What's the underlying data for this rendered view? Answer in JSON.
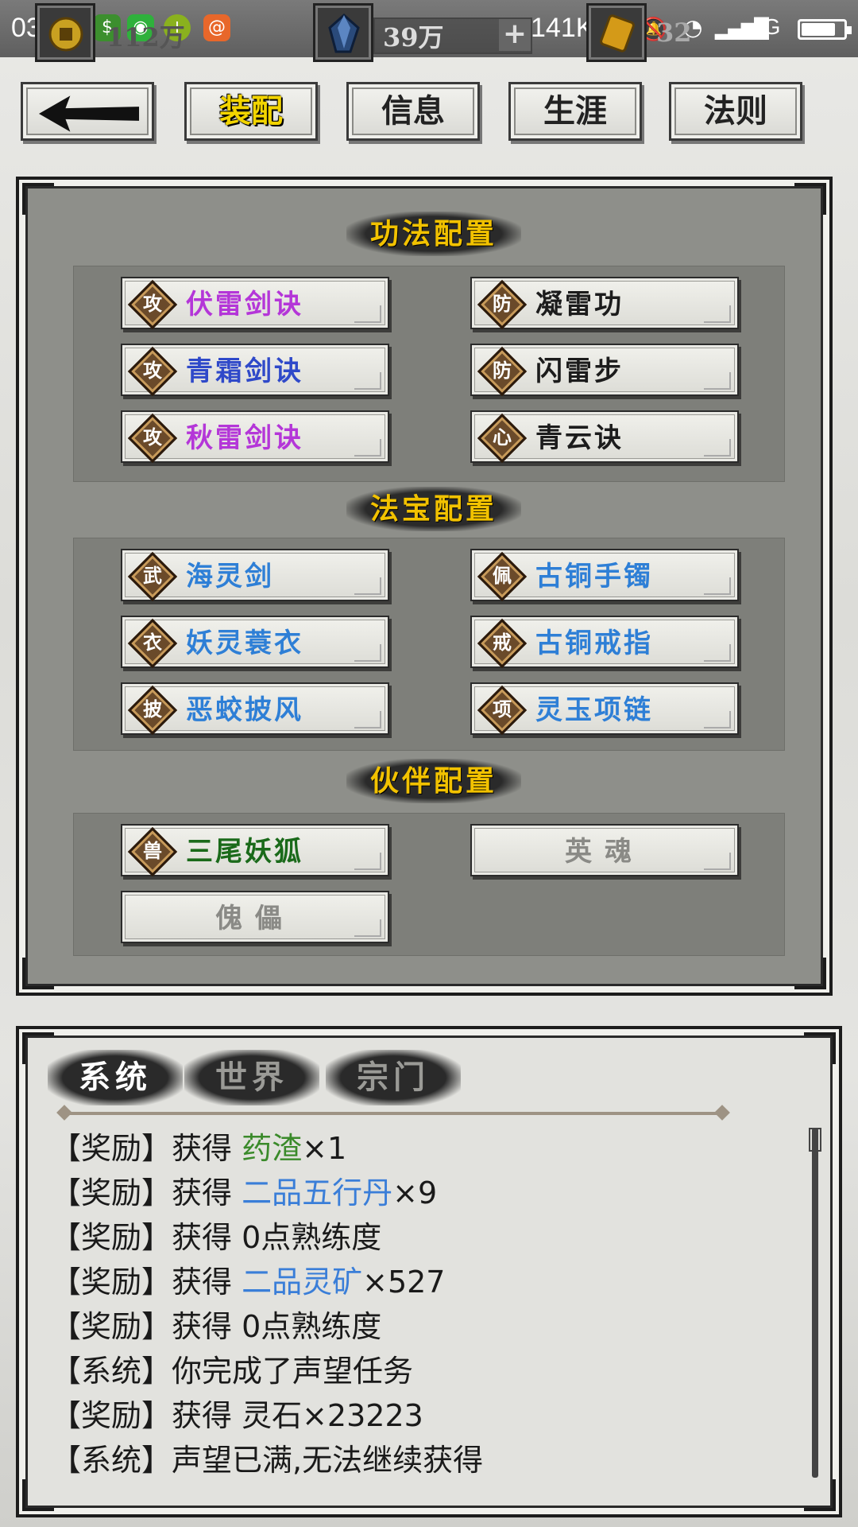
{
  "status_bar": {
    "time": "03:19",
    "net_speed": "141K/s",
    "network": "4G",
    "battery_level": 0.8
  },
  "resources": {
    "gold_partial": "112万",
    "crystal": "39万",
    "third_partial": "32"
  },
  "top_nav": {
    "back_label": "",
    "tabs": [
      {
        "label": "装配",
        "active": true
      },
      {
        "label": "信息",
        "active": false
      },
      {
        "label": "生涯",
        "active": false
      },
      {
        "label": "法则",
        "active": false
      }
    ]
  },
  "sections": {
    "skills": {
      "title": "功法配置",
      "slots": [
        {
          "badge": "攻",
          "name": "伏雷剑诀",
          "color": "#b436d8"
        },
        {
          "badge": "防",
          "name": "凝雷功",
          "color": "#1c1c1c"
        },
        {
          "badge": "攻",
          "name": "青霜剑诀",
          "color": "#2f49c9"
        },
        {
          "badge": "防",
          "name": "闪雷步",
          "color": "#1c1c1c"
        },
        {
          "badge": "攻",
          "name": "秋雷剑诀",
          "color": "#b436d8"
        },
        {
          "badge": "心",
          "name": "青云诀",
          "color": "#1c1c1c"
        }
      ]
    },
    "treasures": {
      "title": "法宝配置",
      "slots": [
        {
          "badge": "武",
          "name": "海灵剑",
          "color": "#2e7fd6"
        },
        {
          "badge": "佩",
          "name": "古铜手镯",
          "color": "#2e7fd6"
        },
        {
          "badge": "衣",
          "name": "妖灵蓑衣",
          "color": "#2e7fd6"
        },
        {
          "badge": "戒",
          "name": "古铜戒指",
          "color": "#2e7fd6"
        },
        {
          "badge": "披",
          "name": "恶蛟披风",
          "color": "#2e7fd6"
        },
        {
          "badge": "项",
          "name": "灵玉项链",
          "color": "#2e7fd6"
        }
      ]
    },
    "partners": {
      "title": "伙伴配置",
      "slots": [
        {
          "badge": "兽",
          "name": "三尾妖狐",
          "color": "#1a6a1a"
        },
        {
          "badge": "",
          "name": "英魂",
          "color": "#8a8a86",
          "empty": true
        },
        {
          "badge": "",
          "name": "傀儡",
          "color": "#8a8a86",
          "empty": true
        }
      ]
    }
  },
  "chat": {
    "tabs": [
      {
        "label": "系统",
        "active": true
      },
      {
        "label": "世界",
        "active": false
      },
      {
        "label": "宗门",
        "active": false
      }
    ],
    "messages": [
      {
        "prefix": "【奖励】获得 ",
        "item": "药渣",
        "item_color": "green",
        "suffix": "×1"
      },
      {
        "prefix": "【奖励】获得 ",
        "item": "二品五行丹",
        "item_color": "blue",
        "suffix": "×9"
      },
      {
        "prefix": "【奖励】获得 0点熟练度",
        "item": "",
        "item_color": "",
        "suffix": ""
      },
      {
        "prefix": "【奖励】获得 ",
        "item": "二品灵矿",
        "item_color": "blue",
        "suffix": "×527"
      },
      {
        "prefix": "【奖励】获得 0点熟练度",
        "item": "",
        "item_color": "",
        "suffix": ""
      },
      {
        "prefix": "【系统】你完成了声望任务",
        "item": "",
        "item_color": "",
        "suffix": ""
      },
      {
        "prefix": "【奖励】获得 灵石×23223",
        "item": "",
        "item_color": "",
        "suffix": ""
      },
      {
        "prefix": "【系统】声望已满,无法继续获得",
        "item": "",
        "item_color": "",
        "suffix": ""
      }
    ]
  }
}
